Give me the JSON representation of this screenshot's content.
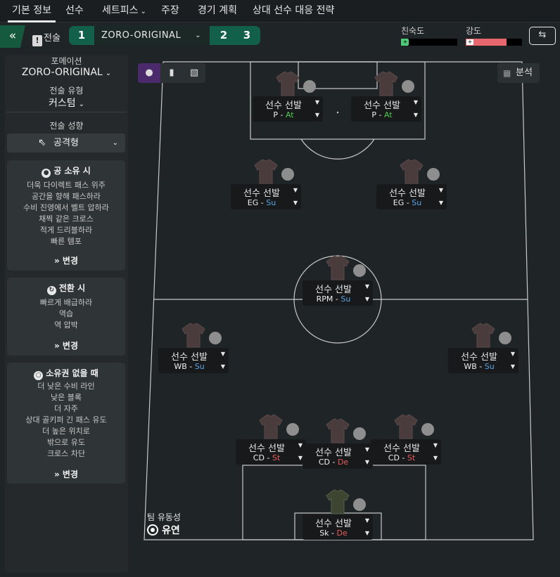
{
  "tabs": [
    {
      "label": "기본 정보",
      "active": true
    },
    {
      "label": "선수"
    },
    {
      "label": "세트피스",
      "dropdown": true
    },
    {
      "label": "주장"
    },
    {
      "label": "경기 계획"
    },
    {
      "label": "상대 선수 대응 전략"
    }
  ],
  "subbar": {
    "tactic_label": "전술",
    "tactic_slots": [
      "1",
      "2",
      "3"
    ],
    "tactic_name": "ZORO-ORIGINAL",
    "familiarity_label": "친숙도",
    "familiarity_level": 0.12,
    "intensity_label": "강도",
    "intensity_level": 0.72,
    "colors": {
      "familiarity": "#4ecb7a",
      "intensity": "#e8666e"
    }
  },
  "left_panel": {
    "formation_label": "포메이션",
    "formation_value": "ZORO-ORIGINAL",
    "tactic_type_label": "전술 유형",
    "tactic_type_value": "커스텀",
    "mentality_label": "전술 성향",
    "mentality_value": "공격형",
    "in_possession": {
      "title": "공 소유 시",
      "items": [
        "더욱 다이렉트 패스 위주",
        "공간을 향해 패스하라",
        "수비 진영에서 벨트 압하라",
        "채찍 같은 크로스",
        "적게 드리블하라",
        "빠른 템포"
      ],
      "button": "변경"
    },
    "transition": {
      "title": "전환 시",
      "items": [
        "빠르게 배급하라",
        "역습",
        "역 압박"
      ],
      "button": "변경"
    },
    "out_of_possession": {
      "title": "소유권 없을 때",
      "items": [
        "더 낮은 수비 라인",
        "낮은 블록",
        "더 자주",
        "상대 골키퍼 긴 패스 유도",
        "더 높은 위치로",
        "밖으로 유도",
        "크로스 차단"
      ],
      "button": "변경"
    }
  },
  "pitch": {
    "analysis_label": "분석",
    "fluidity_label": "팀 유동성",
    "fluidity_value": "유연",
    "players": [
      {
        "id": "p-left",
        "name": "선수 선발",
        "role": "P",
        "duty": "At",
        "duty_color": "#4ecb4e"
      },
      {
        "id": "p-right",
        "name": "선수 선발",
        "role": "P",
        "duty": "At",
        "duty_color": "#4ecb4e"
      },
      {
        "id": "eg-left",
        "name": "선수 선발",
        "role": "EG",
        "duty": "Su",
        "duty_color": "#5aa6e6"
      },
      {
        "id": "eg-right",
        "name": "선수 선발",
        "role": "EG",
        "duty": "Su",
        "duty_color": "#5aa6e6"
      },
      {
        "id": "rpm",
        "name": "선수 선발",
        "role": "RPM",
        "duty": "Su",
        "duty_color": "#5aa6e6"
      },
      {
        "id": "wb-left",
        "name": "선수 선발",
        "role": "WB",
        "duty": "Su",
        "duty_color": "#5aa6e6"
      },
      {
        "id": "wb-right",
        "name": "선수 선발",
        "role": "WB",
        "duty": "Su",
        "duty_color": "#5aa6e6"
      },
      {
        "id": "cd-left",
        "name": "선수 선발",
        "role": "CD",
        "duty": "St",
        "duty_color": "#e85c5c"
      },
      {
        "id": "cd-center",
        "name": "선수 선발",
        "role": "CD",
        "duty": "De",
        "duty_color": "#e85c5c"
      },
      {
        "id": "cd-right",
        "name": "선수 선발",
        "role": "CD",
        "duty": "St",
        "duty_color": "#e85c5c"
      },
      {
        "id": "sk",
        "name": "선수 선발",
        "role": "Sk",
        "duty": "De",
        "duty_color": "#e85c5c"
      }
    ]
  }
}
